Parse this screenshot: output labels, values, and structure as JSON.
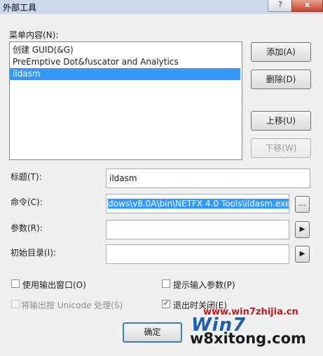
{
  "window": {
    "title": "外部工具",
    "help": "?",
    "close": "x"
  },
  "menu_label": "菜单内容(N):",
  "menu_items": [
    {
      "label": "创建 GUID(&G)"
    },
    {
      "label": "PreEmptive Dot&fuscator and Analytics"
    },
    {
      "label": "ildasm"
    }
  ],
  "buttons": {
    "add": "添加(A)",
    "delete": "删除(D)",
    "move_up": "上移(U)",
    "move_down": "下移(W)",
    "ok": "确定",
    "browse": "...",
    "arrow": "▶"
  },
  "fields": {
    "title_label": "标题(T):",
    "title_value": "ildasm",
    "command_label": "命令(C):",
    "command_value": "dows\\v8.0A\\bin\\NETFX 4.0 Tools\\ildasm.exe",
    "args_label": "参数(R):",
    "args_value": "",
    "initdir_label": "初始目录(I):",
    "initdir_value": ""
  },
  "checks": {
    "use_output": "使用输出窗口(O)",
    "use_output_checked": false,
    "prompt_args": "提示输入参数(P)",
    "prompt_args_checked": false,
    "unicode": "将输出按 Unicode 处理(S)",
    "unicode_checked": false,
    "close_on_exit": "退出时关闭(E)",
    "close_on_exit_checked": true,
    "checkmark": "✓"
  },
  "watermark": {
    "url": "www.win7zhijia.cn",
    "logo": "Win7",
    "site": "w8xitong.com"
  }
}
